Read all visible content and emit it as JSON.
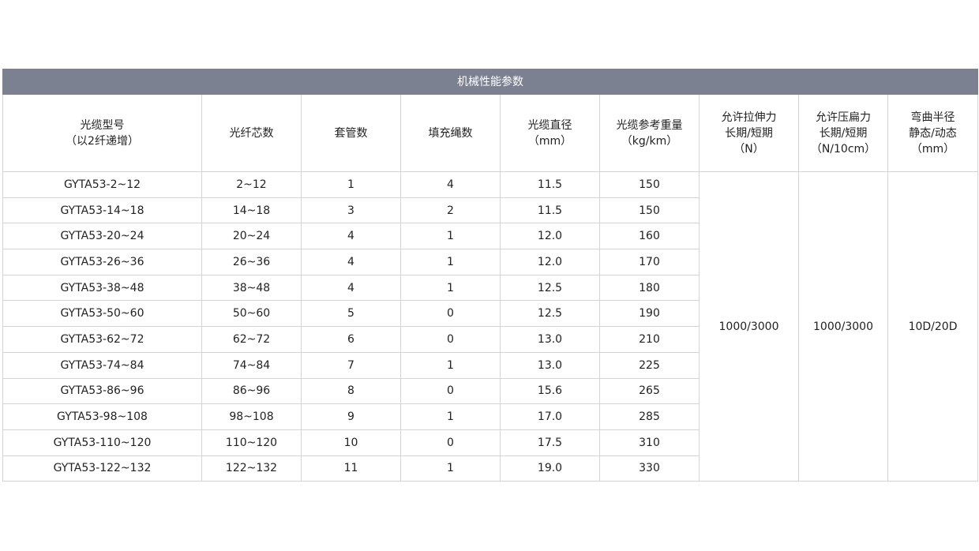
{
  "table": {
    "title": "机械性能参数",
    "headers": [
      [
        "光缆型号",
        "（以2纤递增）"
      ],
      [
        "光纤芯数"
      ],
      [
        "套管数"
      ],
      [
        "填充绳数"
      ],
      [
        "光缆直径",
        "（mm）"
      ],
      [
        "光缆参考重量",
        "（kg/km）"
      ],
      [
        "允许拉伸力",
        "长期/短期",
        "（N）"
      ],
      [
        "允许压扁力",
        "长期/短期",
        "（N/10cm）"
      ],
      [
        "弯曲半径",
        "静态/动态",
        "（mm）"
      ]
    ],
    "rows": [
      [
        "GYTA53-2~12",
        "2~12",
        "1",
        "4",
        "11.5",
        "150"
      ],
      [
        "GYTA53-14~18",
        "14~18",
        "3",
        "2",
        "11.5",
        "150"
      ],
      [
        "GYTA53-20~24",
        "20~24",
        "4",
        "1",
        "12.0",
        "160"
      ],
      [
        "GYTA53-26~36",
        "26~36",
        "4",
        "1",
        "12.0",
        "170"
      ],
      [
        "GYTA53-38~48",
        "38~48",
        "4",
        "1",
        "12.5",
        "180"
      ],
      [
        "GYTA53-50~60",
        "50~60",
        "5",
        "0",
        "12.5",
        "190"
      ],
      [
        "GYTA53-62~72",
        "62~72",
        "6",
        "0",
        "13.0",
        "210"
      ],
      [
        "GYTA53-74~84",
        "74~84",
        "7",
        "1",
        "13.0",
        "225"
      ],
      [
        "GYTA53-86~96",
        "86~96",
        "8",
        "0",
        "15.6",
        "265"
      ],
      [
        "GYTA53-98~108",
        "98~108",
        "9",
        "1",
        "17.0",
        "285"
      ],
      [
        "GYTA53-110~120",
        "110~120",
        "10",
        "0",
        "17.5",
        "310"
      ],
      [
        "GYTA53-122~132",
        "122~132",
        "11",
        "1",
        "19.0",
        "330"
      ]
    ],
    "merged": {
      "tensile": "1000/3000",
      "crush": "1000/3000",
      "bend": "10D/20D"
    }
  },
  "colors": {
    "title_bar": "#7b8191",
    "border": "#d4d4d4"
  }
}
